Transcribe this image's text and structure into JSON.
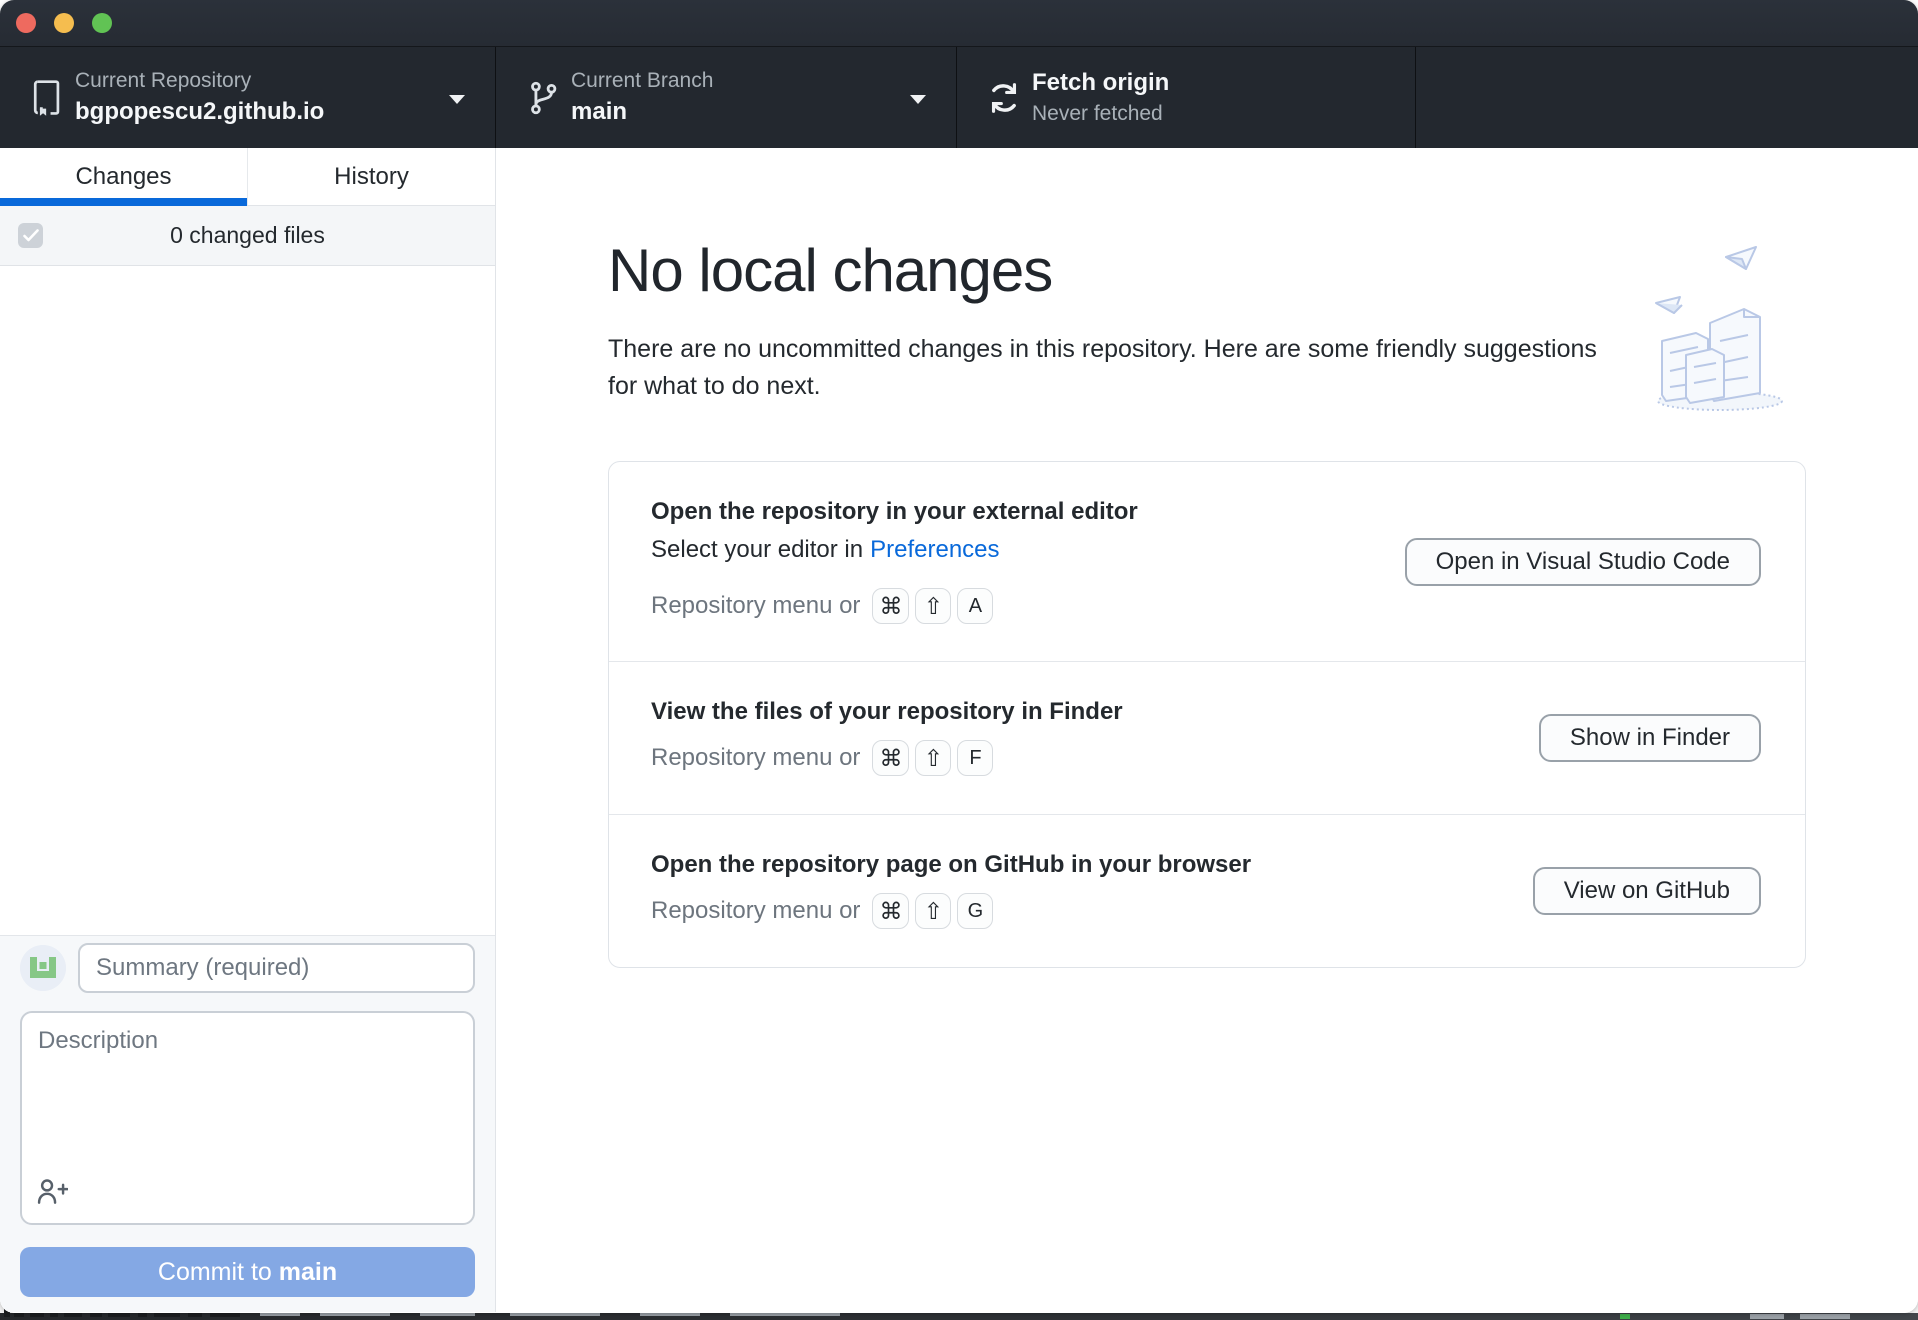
{
  "toolbar": {
    "repository": {
      "label": "Current Repository",
      "value": "bgpopescu2.github.io"
    },
    "branch": {
      "label": "Current Branch",
      "value": "main"
    },
    "fetch": {
      "title": "Fetch origin",
      "subtitle": "Never fetched"
    }
  },
  "sidebar": {
    "tabs": {
      "changes": "Changes",
      "history": "History"
    },
    "changed_files_label": "0 changed files",
    "commit": {
      "summary_placeholder": "Summary (required)",
      "description_placeholder": "Description",
      "button_prefix": "Commit to ",
      "branch": "main"
    }
  },
  "main": {
    "title": "No local changes",
    "subtitle": "There are no uncommitted changes in this repository. Here are some friendly suggestions for what to do next.",
    "suggestions": [
      {
        "title": "Open the repository in your external editor",
        "subtitle_prefix": "Select your editor in",
        "subtitle_link": "Preferences",
        "shortcut_label": "Repository menu or",
        "keys": [
          "⌘",
          "⇧",
          "A"
        ],
        "button": "Open in Visual Studio Code"
      },
      {
        "title": "View the files of your repository in Finder",
        "shortcut_label": "Repository menu or",
        "keys": [
          "⌘",
          "⇧",
          "F"
        ],
        "button": "Show in Finder"
      },
      {
        "title": "Open the repository page on GitHub in your browser",
        "shortcut_label": "Repository menu or",
        "keys": [
          "⌘",
          "⇧",
          "G"
        ],
        "button": "View on GitHub"
      }
    ]
  },
  "colors": {
    "accent_blue": "#0969da",
    "tab_underline": "#0969da",
    "commit_button_blue": "#84a8e4",
    "toolbar_bg": "#23282f",
    "titlebar_bg": "#282d35",
    "traffic_red": "#ee6a5f",
    "traffic_yellow": "#f5bd4f",
    "traffic_green": "#61c354"
  }
}
